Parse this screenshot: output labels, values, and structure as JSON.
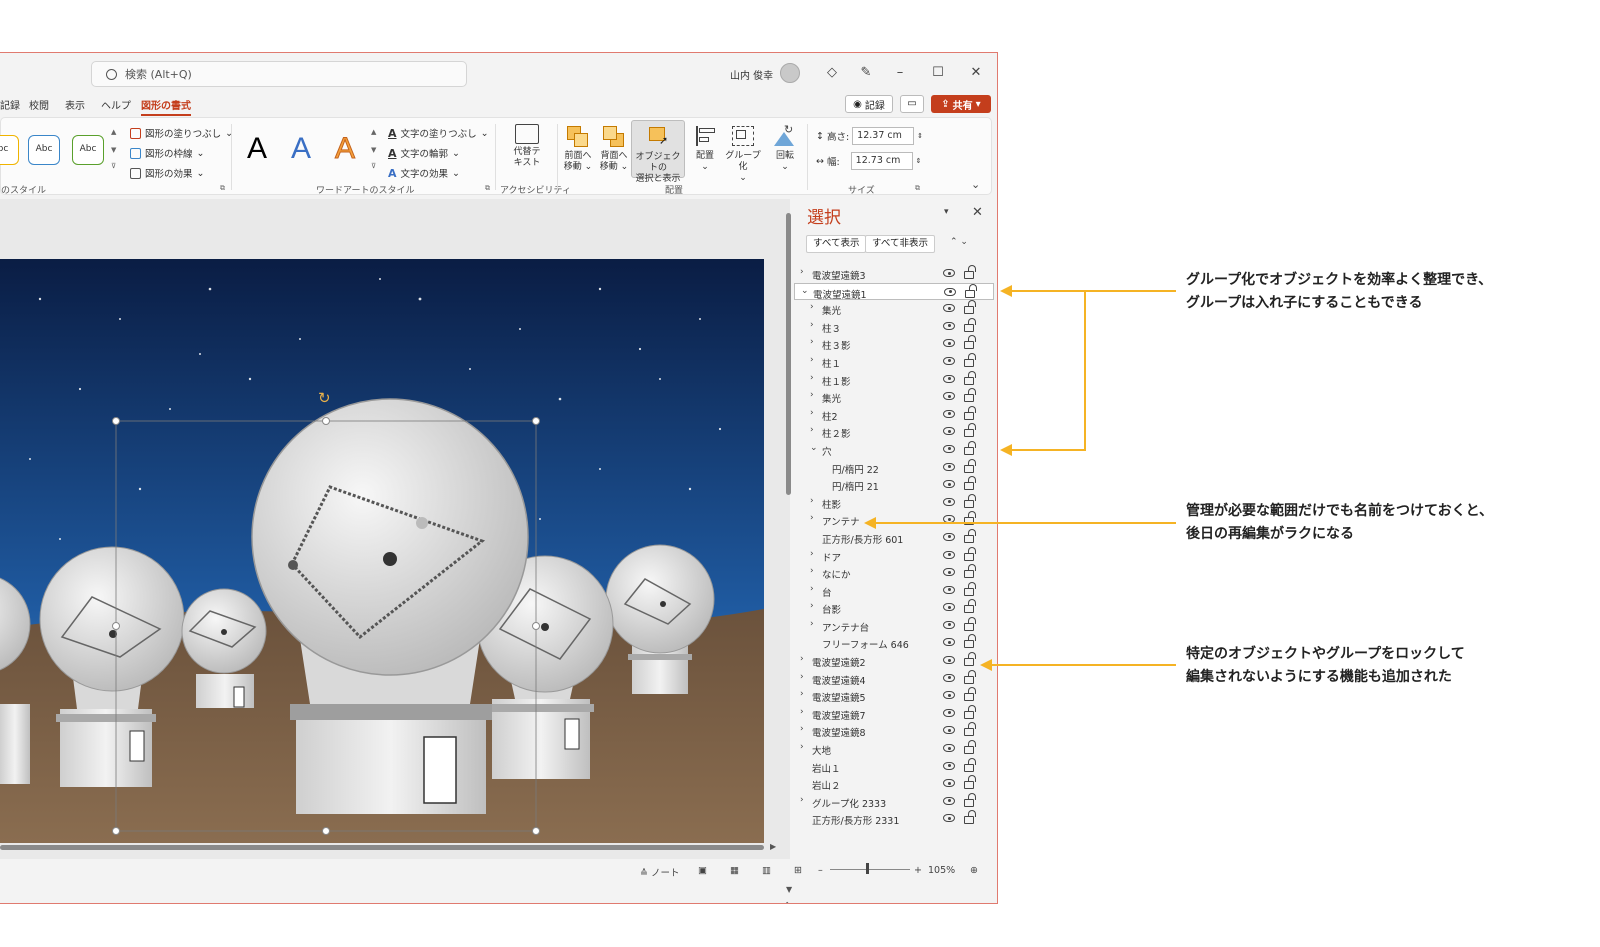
{
  "titlebar": {
    "search_placeholder": "検索 (Alt+Q)",
    "user_name": "山内 俊幸"
  },
  "tabs": [
    {
      "label": "記録"
    },
    {
      "label": "校閲"
    },
    {
      "label": "表示"
    },
    {
      "label": "ヘルプ"
    },
    {
      "label": "図形の書式"
    }
  ],
  "actions": {
    "record_label": "記録",
    "share_label": "共有"
  },
  "ribbon": {
    "shape_styles": {
      "label": "のスタイル",
      "abc": [
        "bc",
        "Abc",
        "Abc"
      ],
      "fill": "図形の塗りつぶし",
      "outline": "図形の枠線",
      "effects": "図形の効果"
    },
    "wordart": {
      "label": "ワードアートのスタイル",
      "letters": [
        "A",
        "A",
        "A"
      ],
      "text_fill": "文字の塗りつぶし",
      "text_outline": "文字の輪郭",
      "text_effects": "文字の効果"
    },
    "accessibility": {
      "label": "アクセシビリティ",
      "alt_text": [
        "代替テ",
        "キスト"
      ]
    },
    "arrange": {
      "label": "配置",
      "bring_forward": [
        "前面へ",
        "移動"
      ],
      "send_backward": [
        "背面へ",
        "移動"
      ],
      "selection_pane": [
        "オブジェクトの",
        "選択と表示"
      ],
      "align": "配置",
      "group": "グループ化",
      "rotate": "回転"
    },
    "size": {
      "label": "サイズ",
      "height_label": "高さ:",
      "height_value": "12.37 cm",
      "width_label": "幅:",
      "width_value": "12.73 cm"
    }
  },
  "selection_pane": {
    "title": "選択",
    "show_all": "すべて表示",
    "hide_all": "すべて非表示",
    "items": [
      {
        "label": "電波望遠鏡3",
        "level": 0,
        "expander": "collapsed"
      },
      {
        "label": "電波望遠鏡1",
        "level": 0,
        "expander": "expanded",
        "selected": true
      },
      {
        "label": "集光",
        "level": 1,
        "expander": "collapsed"
      },
      {
        "label": "柱３",
        "level": 1,
        "expander": "collapsed"
      },
      {
        "label": "柱３影",
        "level": 1,
        "expander": "collapsed"
      },
      {
        "label": "柱１",
        "level": 1,
        "expander": "collapsed"
      },
      {
        "label": "柱１影",
        "level": 1,
        "expander": "collapsed"
      },
      {
        "label": "集光",
        "level": 1,
        "expander": "collapsed"
      },
      {
        "label": "柱2",
        "level": 1,
        "expander": "collapsed"
      },
      {
        "label": "柱２影",
        "level": 1,
        "expander": "collapsed"
      },
      {
        "label": "穴",
        "level": 1,
        "expander": "expanded"
      },
      {
        "label": "円/楕円 22",
        "level": 2,
        "expander": "none"
      },
      {
        "label": "円/楕円 21",
        "level": 2,
        "expander": "none"
      },
      {
        "label": "柱影",
        "level": 1,
        "expander": "collapsed"
      },
      {
        "label": "アンテナ",
        "level": 1,
        "expander": "collapsed"
      },
      {
        "label": "正方形/長方形 601",
        "level": 1,
        "expander": "none"
      },
      {
        "label": "ドア",
        "level": 1,
        "expander": "collapsed"
      },
      {
        "label": "なにか",
        "level": 1,
        "expander": "collapsed"
      },
      {
        "label": "台",
        "level": 1,
        "expander": "collapsed"
      },
      {
        "label": "台影",
        "level": 1,
        "expander": "collapsed"
      },
      {
        "label": "アンテナ台",
        "level": 1,
        "expander": "collapsed"
      },
      {
        "label": "フリーフォーム 646",
        "level": 1,
        "expander": "none"
      },
      {
        "label": "電波望遠鏡2",
        "level": 0,
        "expander": "collapsed"
      },
      {
        "label": "電波望遠鏡4",
        "level": 0,
        "expander": "collapsed"
      },
      {
        "label": "電波望遠鏡5",
        "level": 0,
        "expander": "collapsed"
      },
      {
        "label": "電波望遠鏡7",
        "level": 0,
        "expander": "collapsed"
      },
      {
        "label": "電波望遠鏡8",
        "level": 0,
        "expander": "collapsed"
      },
      {
        "label": "大地",
        "level": 0,
        "expander": "collapsed"
      },
      {
        "label": "岩山１",
        "level": 0,
        "expander": "none"
      },
      {
        "label": "岩山２",
        "level": 0,
        "expander": "none"
      },
      {
        "label": "グループ化 2333",
        "level": 0,
        "expander": "collapsed"
      },
      {
        "label": "正方形/長方形 2331",
        "level": 0,
        "expander": "none"
      }
    ]
  },
  "statusbar": {
    "notes": "ノート",
    "zoom": "105%"
  },
  "annotations": [
    {
      "lines": [
        "グループ化でオブジェクトを効率よく整理でき、",
        "グループは入れ子にすることもできる"
      ]
    },
    {
      "lines": [
        "管理が必要な範囲だけでも名前をつけておくと、",
        "後日の再編集がラクになる"
      ]
    },
    {
      "lines": [
        "特定のオブジェクトやグループをロックして",
        "編集されないようにする機能も追加された"
      ]
    }
  ],
  "colors": {
    "accent": "#c43e1c",
    "arrow": "#f5b324",
    "sky_top": "#0a1d44",
    "sky_bottom": "#3a86c9",
    "ground": "#7a6148"
  }
}
